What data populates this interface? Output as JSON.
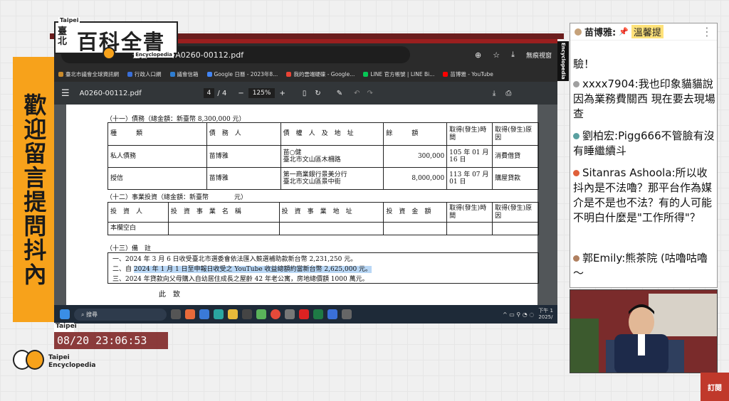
{
  "overlay": {
    "left_banner": "歡迎留言提問抖內",
    "logo_top": {
      "taipei": "Taipei",
      "tai_bei": "臺北",
      "title": "百科全書",
      "encyclopedia": "Encyclopedia"
    },
    "timestamp_label": "Taipei",
    "timestamp": "08/20 23:06:53",
    "bottom_logo": {
      "line1": "Taipei",
      "line2": "Encyclopedia"
    },
    "vertical_label": "Encyclopedia",
    "subscribe": "訂閱"
  },
  "browser": {
    "url": "全書EP105/A0260-00112.pdf",
    "profile": "無痕視窗",
    "bookmarks": [
      "臺北市議會全球資訊網",
      "行政人口網",
      "議會信箱",
      "Google 日曆 - 2023年8...",
      "我的雲端硬碟 - Google...",
      "LINE 官方帳號 | LINE Bi...",
      "苗博雅 - YouTube"
    ],
    "bookmark_colors": [
      "#c98a2b",
      "#3a6fd8",
      "#2e7dd1",
      "#4285f4",
      "#ea4335",
      "#06c755",
      "#ff0000"
    ]
  },
  "pdf": {
    "filename": "A0260-00112.pdf",
    "page_current": "4",
    "page_total": "/ 4",
    "zoom": "125%",
    "debt_title": "（十一）債務（總金額：新臺幣 8,300,000 元）",
    "debt_headers": [
      "種　　　類",
      "債　務　人",
      "債　權　人　及　地　址",
      "餘　　　額",
      "取得(發生)時間",
      "取得(發生)原因"
    ],
    "debt_rows": [
      [
        "私人債務",
        "苗博雅",
        "苗○健\n臺北市文山區木柵路",
        "300,000",
        "105 年 01 月 16 日",
        "消費借貸"
      ],
      [
        "授信",
        "苗博雅",
        "第一商業銀行景美分行\n臺北市文山區景中街",
        "8,000,000",
        "113 年 07 月 01 日",
        "購屋貸款"
      ]
    ],
    "invest_title": "（十二）事業投資（總金額：新臺幣　　　　元）",
    "invest_headers": [
      "投　資　人",
      "投　資　事　業　名　稱",
      "投　資　事　業　地　址",
      "投　資　金　額",
      "取得(發生)時間",
      "取得(發生)原因"
    ],
    "invest_empty": "本欄空白",
    "notes_title": "（十三）備　註",
    "notes": [
      "一、2024 年 3 月 6 日收受臺北市選委會依法匯入競選補助款新台幣 2,231,250 元。",
      "二、自 ",
      "2024 年 1 月 1 日至申報日收受之 YouTube 收益總額約當新台幣 2,625,000 元。",
      "三、2024 年貸款向父母購入自幼居住成長之屋齡 42 年老公寓，房地總價額 1000 萬元。"
    ],
    "closing": "此　致"
  },
  "taskbar": {
    "search": "搜尋",
    "time": "下午 1",
    "date": "2025/"
  },
  "chat": {
    "header_name": "苗博雅:",
    "header_tag": "溫馨提",
    "messages": [
      {
        "name": "",
        "text": "驗！",
        "color": "#fff"
      },
      {
        "name": "xxxx7904:",
        "text": "我也印象貓貓說因為業務費關西 現在要去現場查",
        "color": "#a0a0a0"
      },
      {
        "name": "劉柏宏:",
        "text": "Pigg666不管臉有沒有睡繼續斗",
        "color": "#5aa0a0"
      },
      {
        "name": "Sitanras Ashoola:",
        "text": "所以收抖內是不法嚕？那平台作為媒介是不是也不法？有的人可能不明白什麼是\"工作所得\"？",
        "color": "#e0603a"
      },
      {
        "name": "郭Emily:",
        "text": "熊茶院 (咕嚕咕嚕～",
        "color": "#b08060"
      }
    ]
  }
}
